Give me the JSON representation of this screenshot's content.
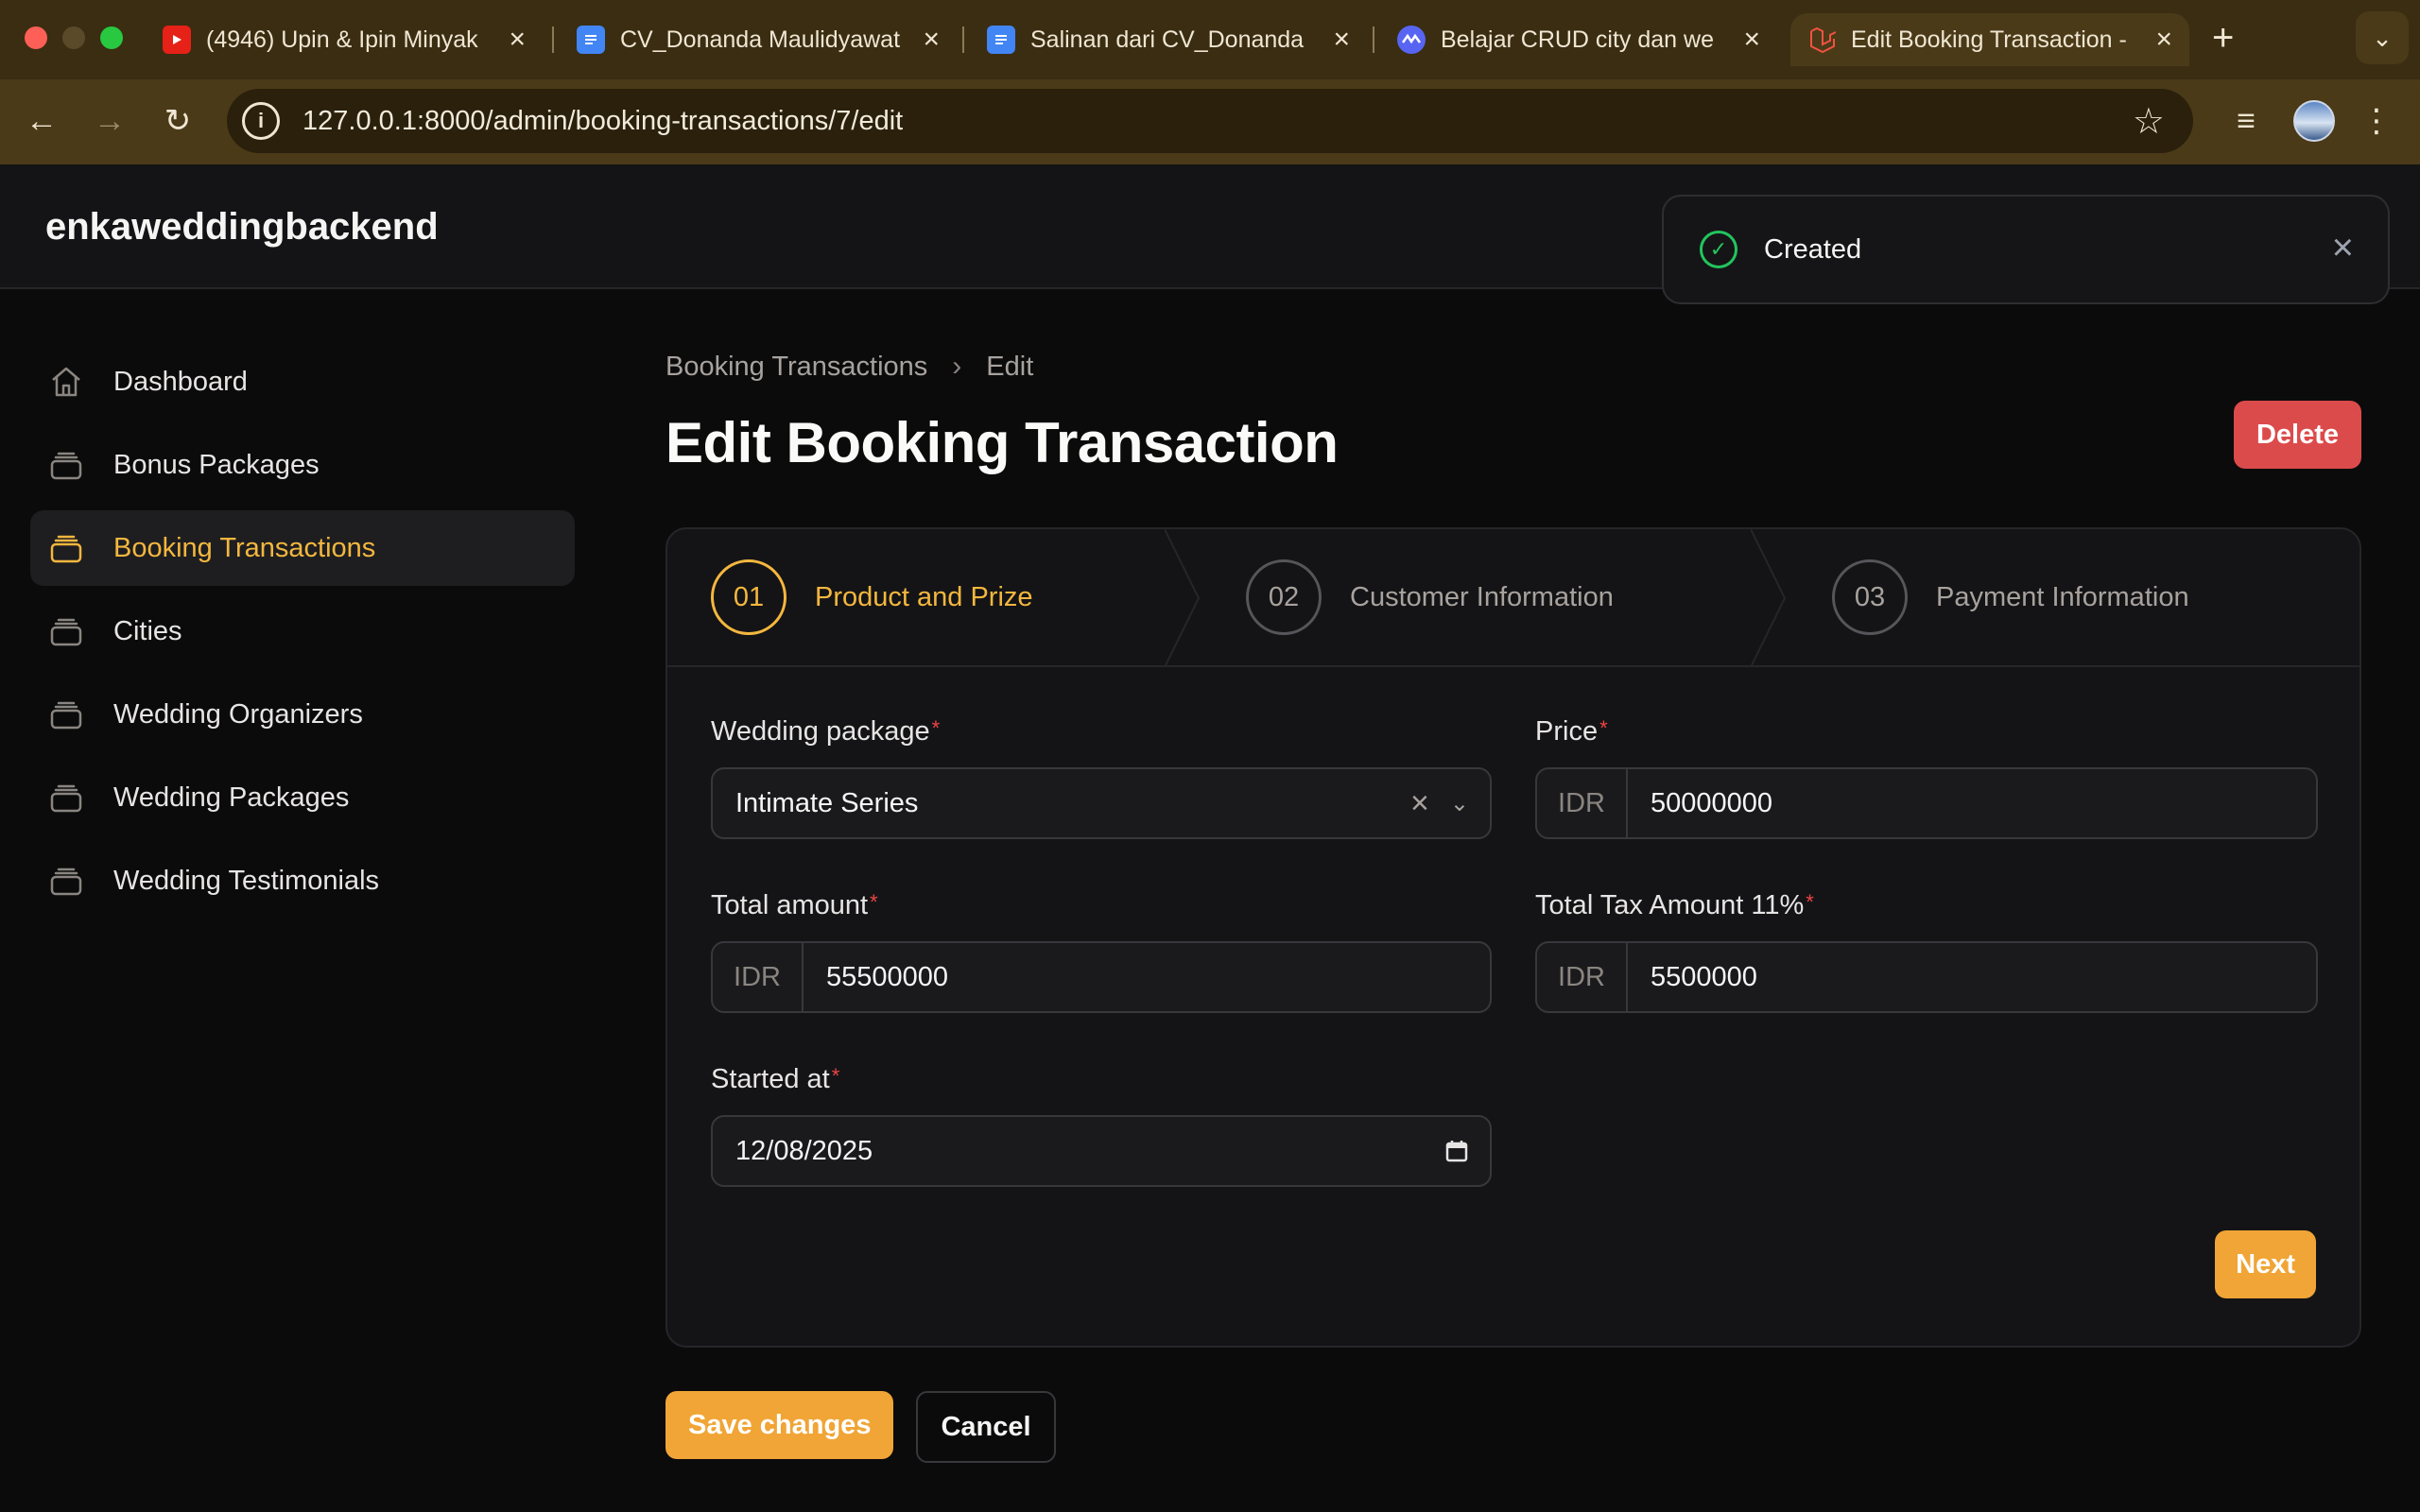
{
  "browser": {
    "tabs": [
      {
        "title": "(4946) Upin & Ipin Minyak",
        "icon": "youtube-icon"
      },
      {
        "title": "CV_Donanda Maulidyawat",
        "icon": "docs-icon"
      },
      {
        "title": "Salinan dari CV_Donanda",
        "icon": "docs-icon"
      },
      {
        "title": "Belajar CRUD city dan we",
        "icon": "site-icon"
      },
      {
        "title": "Edit Booking Transaction -",
        "icon": "laravel-icon"
      }
    ],
    "url": "127.0.0.1:8000/admin/booking-transactions/7/edit"
  },
  "app": {
    "brand": "enkaweddingbackend"
  },
  "toast": {
    "message": "Created"
  },
  "sidebar": {
    "items": [
      {
        "label": "Dashboard",
        "icon": "home-icon"
      },
      {
        "label": "Bonus Packages",
        "icon": "stack-icon"
      },
      {
        "label": "Booking Transactions",
        "icon": "stack-icon"
      },
      {
        "label": "Cities",
        "icon": "stack-icon"
      },
      {
        "label": "Wedding Organizers",
        "icon": "stack-icon"
      },
      {
        "label": "Wedding Packages",
        "icon": "stack-icon"
      },
      {
        "label": "Wedding Testimonials",
        "icon": "stack-icon"
      }
    ],
    "active_index": 2
  },
  "page": {
    "breadcrumb": [
      "Booking Transactions",
      "Edit"
    ],
    "title": "Edit Booking Transaction",
    "delete_label": "Delete"
  },
  "wizard": {
    "steps": [
      {
        "number": "01",
        "label": "Product and Prize"
      },
      {
        "number": "02",
        "label": "Customer Information"
      },
      {
        "number": "03",
        "label": "Payment Information"
      }
    ],
    "active_step": 0,
    "next_label": "Next"
  },
  "form": {
    "wedding_package": {
      "label": "Wedding package",
      "value": "Intimate Series"
    },
    "price": {
      "label": "Price",
      "prefix": "IDR",
      "value": "50000000"
    },
    "total_amount": {
      "label": "Total amount",
      "prefix": "IDR",
      "value": "55500000"
    },
    "total_tax": {
      "label": "Total Tax Amount 11%",
      "prefix": "IDR",
      "value": "5500000"
    },
    "started_at": {
      "label": "Started at",
      "value": "12/08/2025"
    }
  },
  "actions": {
    "save_label": "Save changes",
    "cancel_label": "Cancel"
  },
  "colors": {
    "accent": "#f0a536",
    "danger": "#dc4b4b",
    "success": "#22c55e"
  }
}
